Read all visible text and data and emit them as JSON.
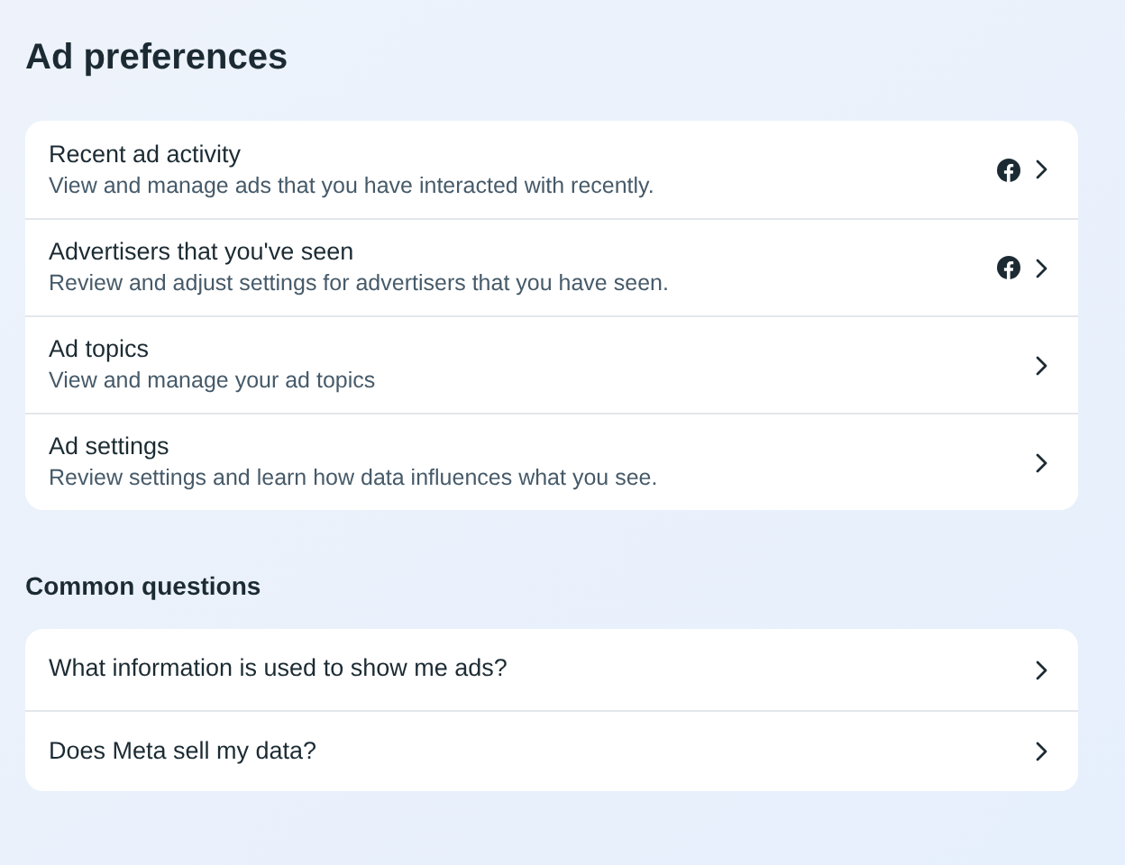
{
  "title": "Ad preferences",
  "preferences": [
    {
      "title": "Recent ad activity",
      "description": "View and manage ads that you have interacted with recently.",
      "platform_icon": true
    },
    {
      "title": "Advertisers that you've seen",
      "description": "Review and adjust settings for advertisers that you have seen.",
      "platform_icon": true
    },
    {
      "title": "Ad topics",
      "description": "View and manage your ad topics",
      "platform_icon": false
    },
    {
      "title": "Ad settings",
      "description": "Review settings and learn how data influences what you see.",
      "platform_icon": false
    }
  ],
  "questions_heading": "Common questions",
  "questions": [
    {
      "title": "What information is used to show me ads?"
    },
    {
      "title": "Does Meta sell my data?"
    }
  ]
}
